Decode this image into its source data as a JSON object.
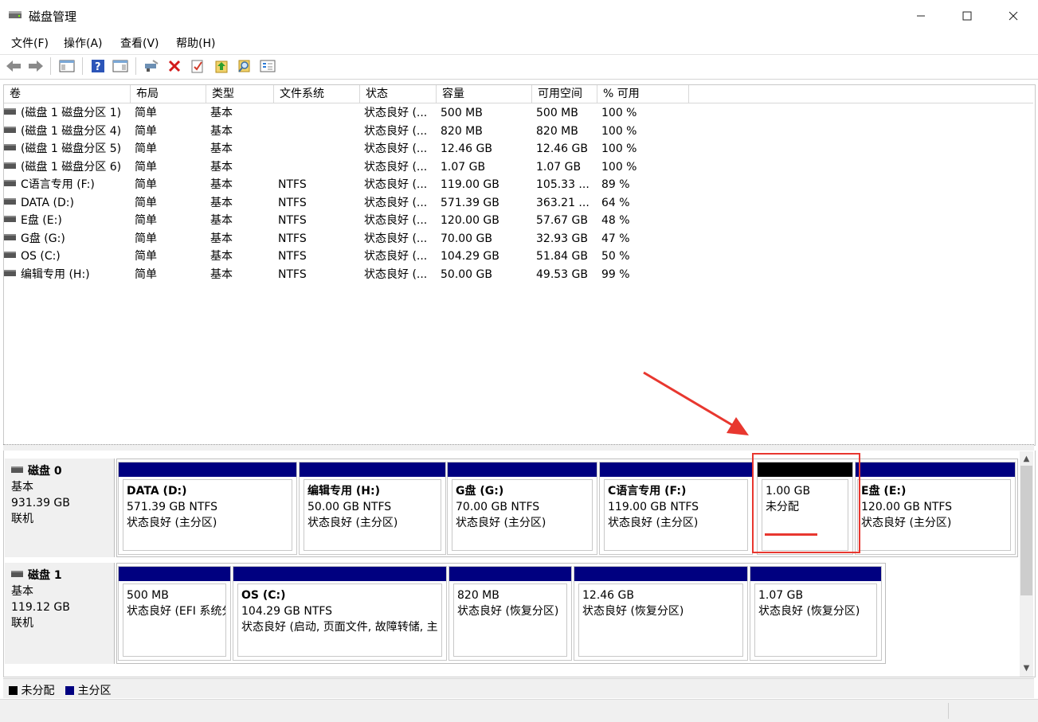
{
  "window": {
    "title": "磁盘管理",
    "min_label": "—",
    "max_label": "☐",
    "close_label": "✕"
  },
  "menu": [
    "文件(F)",
    "操作(A)",
    "查看(V)",
    "帮助(H)"
  ],
  "toolbar_icons": [
    "back-arrow-icon",
    "forward-arrow-icon",
    "console-tree-icon",
    "help-icon",
    "properties-icon",
    "connect-icon",
    "delete-icon",
    "check-icon",
    "import-icon",
    "search-icon",
    "options-icon"
  ],
  "list": {
    "columns": [
      "卷",
      "布局",
      "类型",
      "文件系统",
      "状态",
      "容量",
      "可用空间",
      "% 可用"
    ],
    "rows": [
      [
        "(磁盘 1 磁盘分区 1)",
        "简单",
        "基本",
        "",
        "状态良好 (...",
        "500 MB",
        "500 MB",
        "100 %"
      ],
      [
        "(磁盘 1 磁盘分区 4)",
        "简单",
        "基本",
        "",
        "状态良好 (...",
        "820 MB",
        "820 MB",
        "100 %"
      ],
      [
        "(磁盘 1 磁盘分区 5)",
        "简单",
        "基本",
        "",
        "状态良好 (...",
        "12.46 GB",
        "12.46 GB",
        "100 %"
      ],
      [
        "(磁盘 1 磁盘分区 6)",
        "简单",
        "基本",
        "",
        "状态良好 (...",
        "1.07 GB",
        "1.07 GB",
        "100 %"
      ],
      [
        "C语言专用 (F:)",
        "简单",
        "基本",
        "NTFS",
        "状态良好 (...",
        "119.00 GB",
        "105.33 ...",
        "89 %"
      ],
      [
        "DATA (D:)",
        "简单",
        "基本",
        "NTFS",
        "状态良好 (...",
        "571.39 GB",
        "363.21 ...",
        "64 %"
      ],
      [
        "E盘 (E:)",
        "简单",
        "基本",
        "NTFS",
        "状态良好 (...",
        "120.00 GB",
        "57.67 GB",
        "48 %"
      ],
      [
        "G盘 (G:)",
        "简单",
        "基本",
        "NTFS",
        "状态良好 (...",
        "70.00 GB",
        "32.93 GB",
        "47 %"
      ],
      [
        "OS (C:)",
        "简单",
        "基本",
        "NTFS",
        "状态良好 (...",
        "104.29 GB",
        "51.84 GB",
        "50 %"
      ],
      [
        "编辑专用 (H:)",
        "简单",
        "基本",
        "NTFS",
        "状态良好 (...",
        "50.00 GB",
        "49.53 GB",
        "99 %"
      ]
    ]
  },
  "disks": [
    {
      "name": "磁盘 0",
      "type": "基本",
      "size": "931.39 GB",
      "state": "联机",
      "partitions": [
        {
          "name": "DATA  (D:)",
          "line1": "571.39 GB NTFS",
          "line2": "状态良好 (主分区)",
          "kind": "primary"
        },
        {
          "name": "编辑专用  (H:)",
          "line1": "50.00 GB NTFS",
          "line2": "状态良好 (主分区)",
          "kind": "primary"
        },
        {
          "name": "G盘  (G:)",
          "line1": "70.00 GB NTFS",
          "line2": "状态良好 (主分区)",
          "kind": "primary"
        },
        {
          "name": "C语言专用  (F:)",
          "line1": "119.00 GB NTFS",
          "line2": "状态良好 (主分区)",
          "kind": "primary"
        },
        {
          "name": "",
          "line1": "1.00 GB",
          "line2": "未分配",
          "kind": "unallocated"
        },
        {
          "name": "E盘  (E:)",
          "line1": "120.00 GB NTFS",
          "line2": "状态良好 (主分区)",
          "kind": "primary"
        }
      ]
    },
    {
      "name": "磁盘 1",
      "type": "基本",
      "size": "119.12 GB",
      "state": "联机",
      "partitions": [
        {
          "name": "",
          "line1": "500 MB",
          "line2": "状态良好 (EFI 系统分",
          "kind": "primary"
        },
        {
          "name": "OS  (C:)",
          "line1": "104.29 GB NTFS",
          "line2": "状态良好 (启动, 页面文件, 故障转储, 主",
          "kind": "primary"
        },
        {
          "name": "",
          "line1": "820 MB",
          "line2": "状态良好 (恢复分区)",
          "kind": "primary"
        },
        {
          "name": "",
          "line1": "12.46 GB",
          "line2": "状态良好 (恢复分区)",
          "kind": "primary"
        },
        {
          "name": "",
          "line1": "1.07 GB",
          "line2": "状态良好 (恢复分区)",
          "kind": "primary"
        }
      ]
    }
  ],
  "legend": {
    "unallocated": "未分配",
    "primary": "主分区"
  },
  "colors": {
    "primary": "#000080",
    "unallocated": "#000000",
    "highlight": "#e8372f"
  }
}
